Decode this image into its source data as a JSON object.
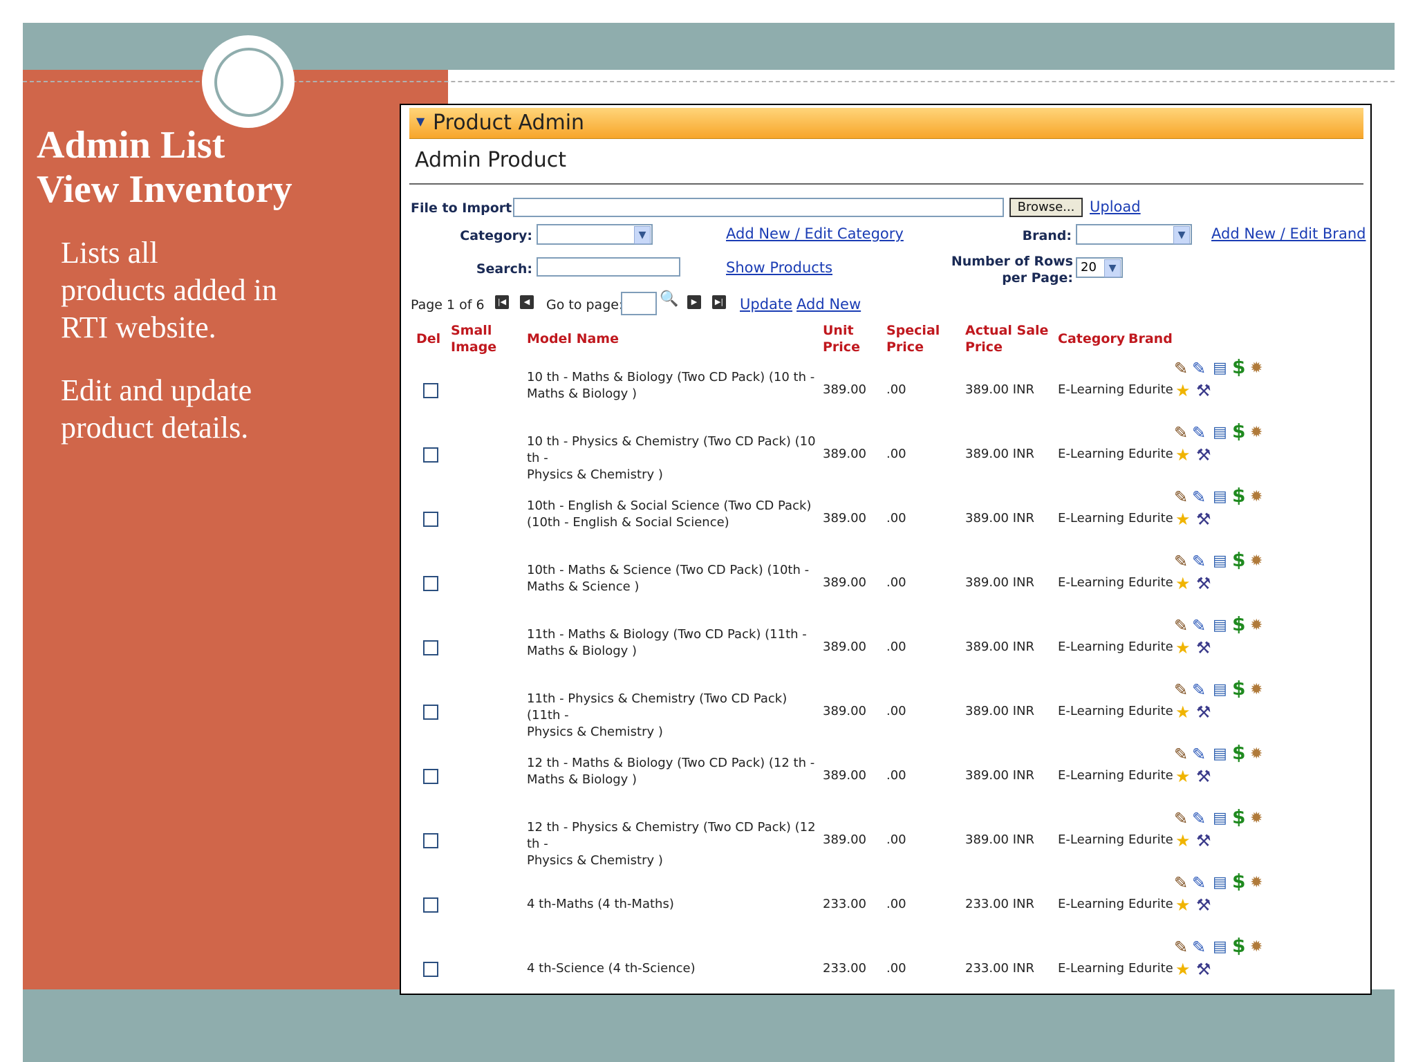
{
  "slide": {
    "title": "Admin List\nView  Inventory",
    "bullets": [
      "  Lists all\nproducts added in\nRTI website.",
      " Edit and update\nproduct details."
    ]
  },
  "panel": {
    "header": "Product Admin",
    "title": "Admin Product"
  },
  "form": {
    "file_label": "File to Import",
    "browse": "Browse...",
    "upload": "Upload",
    "category_label": "Category:",
    "category_link": "Add New / Edit Category",
    "brand_label": "Brand:",
    "brand_link": "Add New / Edit Brand",
    "search_label": "Search:",
    "show_products": "Show Products",
    "rows_label_1": "Number of Rows",
    "rows_label_2": "per Page:",
    "rows_value": "20"
  },
  "pager": {
    "page_text": "Page  1 of 6",
    "goto_label": "Go to page:",
    "update": "Update",
    "add_new": "Add New"
  },
  "columns": {
    "del": "Del",
    "small_image_1": "Small",
    "small_image_2": "Image",
    "model": "Model Name",
    "unit_1": "Unit",
    "unit_2": "Price",
    "special_1": "Special",
    "special_2": "Price",
    "actual_1": "Actual Sale",
    "actual_2": "Price",
    "category": "Category",
    "brand": "Brand"
  },
  "icons": [
    "edit-pencil-icon",
    "edit-blue-pencil-icon",
    "copy-icon",
    "price-dollar-icon",
    "settings-gear-icon",
    "featured-star-icon",
    "tools-icon"
  ],
  "colors": {
    "accent_header": "#f7a52a",
    "link": "#1a3cb4",
    "column_header": "#c0181e",
    "slide_panel": "#d0664a",
    "slide_bar": "#8fadad"
  },
  "rows": [
    {
      "model_1": "10 th - Maths & Biology (Two CD Pack) (10 th -",
      "model_2": "Maths & Biology )",
      "unit": "389.00",
      "special": ".00",
      "actual": "389.00 INR",
      "category": "E-Learning",
      "brand": "Edurite"
    },
    {
      "model_1": "10 th - Physics & Chemistry (Two CD Pack) (10 th -",
      "model_2": "Physics & Chemistry )",
      "unit": "389.00",
      "special": ".00",
      "actual": "389.00 INR",
      "category": "E-Learning",
      "brand": "Edurite"
    },
    {
      "model_1": "10th - English & Social Science (Two CD Pack)",
      "model_2": "(10th - English & Social Science)",
      "unit": "389.00",
      "special": ".00",
      "actual": "389.00 INR",
      "category": "E-Learning",
      "brand": "Edurite"
    },
    {
      "model_1": "10th - Maths & Science (Two CD Pack) (10th -",
      "model_2": "Maths & Science )",
      "unit": "389.00",
      "special": ".00",
      "actual": "389.00 INR",
      "category": "E-Learning",
      "brand": "Edurite"
    },
    {
      "model_1": "11th - Maths & Biology (Two CD Pack) (11th -",
      "model_2": "Maths & Biology )",
      "unit": "389.00",
      "special": ".00",
      "actual": "389.00 INR",
      "category": "E-Learning",
      "brand": "Edurite"
    },
    {
      "model_1": "11th - Physics & Chemistry (Two CD Pack) (11th -",
      "model_2": "Physics & Chemistry )",
      "unit": "389.00",
      "special": ".00",
      "actual": "389.00 INR",
      "category": "E-Learning",
      "brand": "Edurite"
    },
    {
      "model_1": "12 th - Maths & Biology (Two CD Pack) (12 th -",
      "model_2": "Maths & Biology )",
      "unit": "389.00",
      "special": ".00",
      "actual": "389.00 INR",
      "category": "E-Learning",
      "brand": "Edurite"
    },
    {
      "model_1": "12 th - Physics & Chemistry (Two CD Pack) (12 th -",
      "model_2": "Physics & Chemistry )",
      "unit": "389.00",
      "special": ".00",
      "actual": "389.00 INR",
      "category": "E-Learning",
      "brand": "Edurite"
    },
    {
      "model_1": "4 th-Maths (4 th-Maths)",
      "model_2": "",
      "unit": "233.00",
      "special": ".00",
      "actual": "233.00 INR",
      "category": "E-Learning",
      "brand": "Edurite"
    },
    {
      "model_1": "4 th-Science (4 th-Science)",
      "model_2": "",
      "unit": "233.00",
      "special": ".00",
      "actual": "233.00 INR",
      "category": "E-Learning",
      "brand": "Edurite"
    }
  ]
}
